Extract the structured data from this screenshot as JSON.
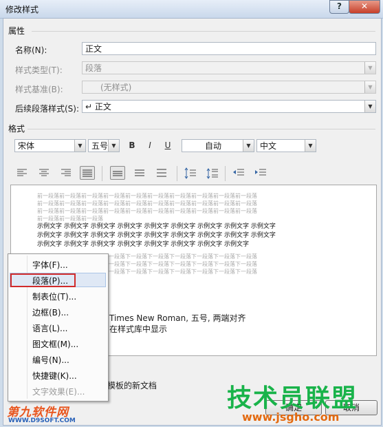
{
  "window": {
    "title": "修改样式",
    "help_label": "?",
    "close_label": "✕"
  },
  "properties": {
    "section_label": "属性",
    "name_label": "名称(N):",
    "name_value": "正文",
    "style_type_label": "样式类型(T):",
    "style_type_value": "段落",
    "style_based_label": "样式基准(B):",
    "style_based_value": "(无样式)",
    "next_style_label": "后续段落样式(S):",
    "next_style_value": "↵ 正文"
  },
  "format": {
    "section_label": "格式",
    "font": "宋体",
    "size": "五号",
    "bold": "B",
    "italic": "I",
    "underline": "U",
    "color": "自动",
    "script": "中文"
  },
  "preview": {
    "prev_lines": [
      "前一段落前一段落前一段落前一段落前一段落前一段落前一段落前一段落前一段落前一段落",
      "前一段落前一段落前一段落前一段落前一段落前一段落前一段落前一段落前一段落前一段落",
      "前一段落前一段落前一段落前一段落前一段落前一段落前一段落前一段落前一段落前一段落",
      "前一段落前一段落前一段落"
    ],
    "sample_lines": [
      "示例文字 示例文字 示例文字 示例文字 示例文字 示例文字 示例文字 示例文字 示例文字",
      "示例文字 示例文字 示例文字 示例文字 示例文字 示例文字 示例文字 示例文字 示例文字",
      "示例文字 示例文字 示例文字 示例文字 示例文字 示例文字 示例文字 示例文字"
    ],
    "next_lines": [
      "下一段落下一段落下一段落下一段落下一段落下一段落下一段落下一段落下一段落下一段落",
      "下一段落下一段落下一段落下一段落下一段落下一段落下一段落下一段落下一段落下一段落",
      "下一段落下一段落下一段落下一段落下一段落下一段落下一段落下一段落下一段落下一段落"
    ]
  },
  "description": {
    "line1": "Times New Roman, 五号, 两端对齐",
    "line2": "在样式库中显示"
  },
  "template_option": "该模板的新文档",
  "menu": {
    "items": [
      "字体(F)...",
      "段落(P)...",
      "制表位(T)...",
      "边框(B)...",
      "语言(L)...",
      "图文框(M)...",
      "编号(N)...",
      "快捷键(K)...",
      "文字效果(E)..."
    ]
  },
  "buttons": {
    "ok": "确定",
    "cancel": "取消"
  },
  "watermarks": {
    "left_logo": "第九软件网",
    "left_url": "WWW.D9SOFT.COM",
    "right_logo": "技术员联盟",
    "right_url": "www.jsgho.com"
  }
}
